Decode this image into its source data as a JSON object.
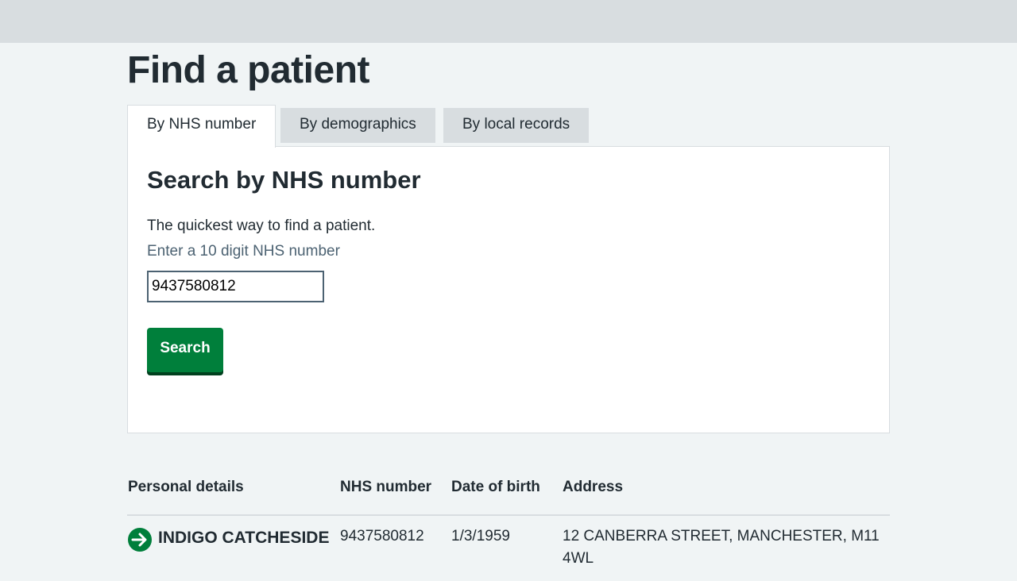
{
  "page": {
    "title": "Find a patient"
  },
  "tabs": [
    {
      "label": "By NHS number",
      "selected": true
    },
    {
      "label": "By demographics",
      "selected": false
    },
    {
      "label": "By local records",
      "selected": false
    }
  ],
  "panel": {
    "heading": "Search by NHS number",
    "description": "The quickest way to find a patient.",
    "hint": "Enter a 10 digit NHS number",
    "input_value": "9437580812",
    "button_label": "Search"
  },
  "results": {
    "headers": [
      "Personal details",
      "NHS number",
      "Date of birth",
      "Address"
    ],
    "rows": [
      {
        "name": "INDIGO CATCHESIDE",
        "nhs_number": "9437580812",
        "dob": "1/3/1959",
        "address": "12 CANBERRA STREET, MANCHESTER, M11 4WL"
      }
    ]
  },
  "colors": {
    "top_bar": "#d8dde0",
    "background": "#f0f4f5",
    "primary_button": "#007f3b",
    "text": "#212b32",
    "hint_text": "#4c6272"
  },
  "icons": {
    "row_link": "arrow-right-circle-icon"
  }
}
